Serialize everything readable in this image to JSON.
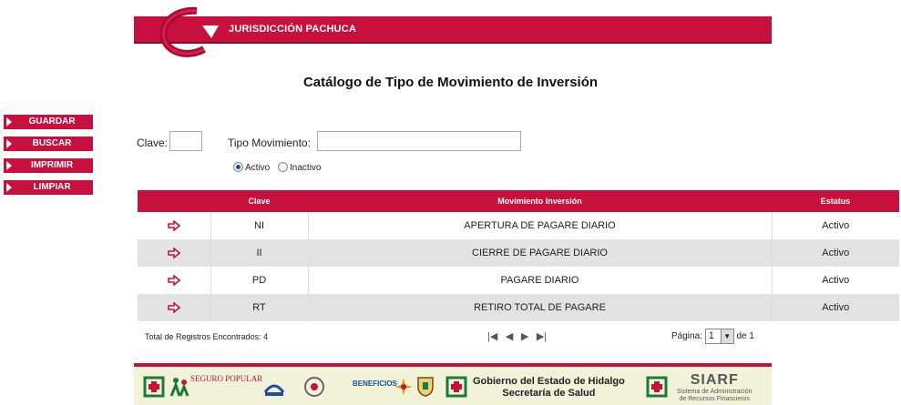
{
  "header": {
    "title": "JURISDICCIÓN PACHUCA",
    "brand_color": "#c8103e"
  },
  "page_title": "Catálogo de Tipo de Movimiento de Inversión",
  "actions": [
    {
      "label": "GUARDAR"
    },
    {
      "label": "BUSCAR"
    },
    {
      "label": "IMPRIMIR"
    },
    {
      "label": "LIMPIAR"
    }
  ],
  "filters": {
    "clave_label": "Clave:",
    "clave_value": "",
    "tipo_label": "Tipo Movimiento:",
    "tipo_value": "",
    "radio_active": "Activo",
    "radio_inactive": "Inactivo",
    "selected": "Activo"
  },
  "table": {
    "headers": [
      "",
      "Clave",
      "Movimiento Inversión",
      "Estatus"
    ],
    "rows": [
      {
        "clave": "NI",
        "movimiento": "APERTURA DE PAGARE DIARIO",
        "estatus": "Activo"
      },
      {
        "clave": "II",
        "movimiento": "CIERRE DE PAGARE DIARIO",
        "estatus": "Activo"
      },
      {
        "clave": "PD",
        "movimiento": "PAGARE DIARIO",
        "estatus": "Activo"
      },
      {
        "clave": "RT",
        "movimiento": "RETIRO TOTAL DE PAGARE",
        "estatus": "Activo"
      }
    ]
  },
  "footer": {
    "total_label": "Total de Registros Encontrados: 4",
    "page_label": "Página:",
    "page_value": "1",
    "page_of": "de 1"
  },
  "logos": {
    "seguro_popular": "SEGURO POPULAR",
    "beneficios": "BENEFICIOS",
    "hidalgo_line1": "Gobierno del Estado de Hidalgo",
    "hidalgo_line2": "Secretaría de Salud",
    "siarf_title": "SIARF",
    "siarf_sub1": "Sistema de Administración",
    "siarf_sub2": "de Recursos Financieros"
  }
}
